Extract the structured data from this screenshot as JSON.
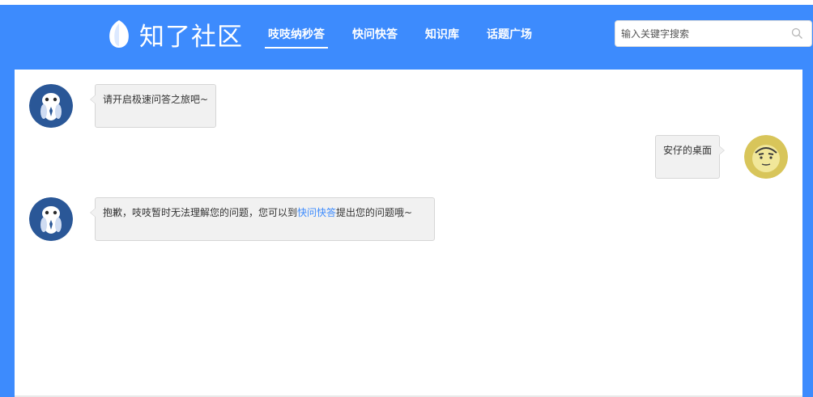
{
  "header": {
    "logo_text": "知了社区",
    "nav": [
      {
        "label": "吱吱纳秒答",
        "active": true
      },
      {
        "label": "快问快答",
        "active": false
      },
      {
        "label": "知识库",
        "active": false
      },
      {
        "label": "话题广场",
        "active": false
      }
    ],
    "search": {
      "placeholder": "输入关键字搜索",
      "value": "",
      "icon": "search-icon"
    }
  },
  "chat": {
    "messages": [
      {
        "from": "bot",
        "avatar": "bot-avatar",
        "text": "请开启极速问答之旅吧~"
      },
      {
        "from": "user",
        "avatar": "user-avatar",
        "text": "安仔的桌面"
      },
      {
        "from": "bot",
        "avatar": "bot-avatar",
        "text_before": "抱歉，吱吱暂时无法理解您的问题，您可以到",
        "link_text": "快问快答",
        "text_after": "提出您的问题哦~"
      }
    ]
  },
  "colors": {
    "brand": "#3d8bfd",
    "bubble_bg": "#f1f1f1",
    "bot_avatar_bg": "#2a5797",
    "user_avatar_bg": "#d8c55a"
  }
}
